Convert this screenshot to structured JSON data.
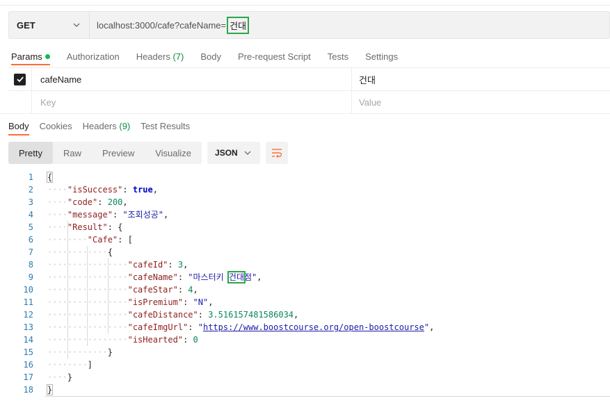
{
  "request": {
    "method": "GET",
    "url_prefix": "localhost:3000/cafe?cafeName=",
    "url_highlight": "건대"
  },
  "request_tabs": [
    {
      "label": "Params",
      "active": true,
      "dot": true
    },
    {
      "label": "Authorization"
    },
    {
      "label": "Headers",
      "count": "(7)"
    },
    {
      "label": "Body"
    },
    {
      "label": "Pre-request Script"
    },
    {
      "label": "Tests"
    },
    {
      "label": "Settings"
    }
  ],
  "params": {
    "rows": [
      {
        "checked": true,
        "key": "cafeName",
        "value": "건대"
      }
    ],
    "key_placeholder": "Key",
    "value_placeholder": "Value"
  },
  "response_tabs": [
    {
      "label": "Body",
      "active": true
    },
    {
      "label": "Cookies"
    },
    {
      "label": "Headers",
      "count": "(9)"
    },
    {
      "label": "Test Results"
    }
  ],
  "view_modes": [
    "Pretty",
    "Raw",
    "Preview",
    "Visualize"
  ],
  "active_view": "Pretty",
  "format": "JSON",
  "icons": {
    "method_dropdown": "chevron-down-icon",
    "format_dropdown": "chevron-down-icon",
    "wrap": "wrap-lines-icon",
    "checkbox": "checkmark-icon"
  },
  "colors": {
    "accent": "#ff6c37",
    "highlight_box": "#2aa84a",
    "status_dot": "#0cbb52",
    "count_green": "#0a8f3c"
  },
  "response_json": {
    "line_numbers": [
      "1",
      "2",
      "3",
      "4",
      "5",
      "6",
      "7",
      "8",
      "9",
      "10",
      "11",
      "12",
      "13",
      "14",
      "15",
      "16",
      "17",
      "18"
    ],
    "isSuccess": "true",
    "code": "200",
    "message": "\"조회성공\"",
    "cafeId": "3",
    "cafeName_before": "\"마스터키 ",
    "cafeName_highlight": "건대",
    "cafeName_after": "점\"",
    "cafeStar": "4",
    "isPremium": "\"N\"",
    "cafeDistance": "3.516157481586034",
    "cafeImgUrl": "https://www.boostcourse.org/open-boostcourse",
    "isHearted": "0"
  }
}
